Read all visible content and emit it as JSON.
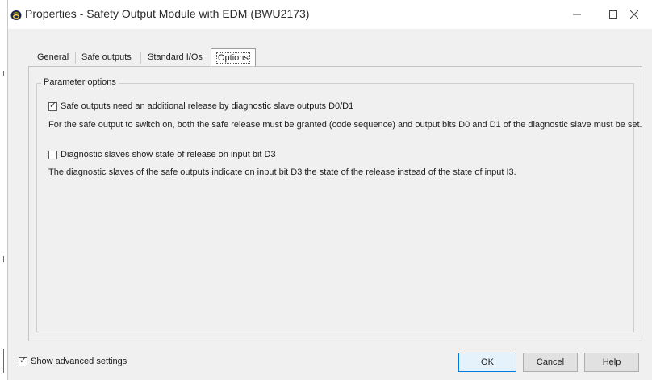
{
  "window": {
    "title": "Properties - Safety Output Module with EDM (BWU2173)",
    "minimize_glyph": "—",
    "maximize_glyph": "☐",
    "close_glyph": "✕"
  },
  "tabs": [
    {
      "label": "General",
      "active": false
    },
    {
      "label": "Safe outputs",
      "active": false
    },
    {
      "label": "Standard I/Os",
      "active": false
    },
    {
      "label": "Options",
      "active": true
    }
  ],
  "options": {
    "group_title": "Parameter options",
    "option1": {
      "label": "Safe outputs need an additional release by diagnostic slave outputs D0/D1",
      "checked": true,
      "description": "For the safe output to switch on, both the safe release must be granted (code sequence) and output bits D0 and D1 of the diagnostic slave must be set."
    },
    "option2": {
      "label": "Diagnostic slaves show state of release on input bit D3",
      "checked": false,
      "description": "The diagnostic slaves of the safe outputs indicate on input bit D3 the state of the release instead of the state of input I3."
    }
  },
  "footer": {
    "show_advanced": {
      "label": "Show advanced settings",
      "checked": true
    },
    "ok_label": "OK",
    "cancel_label": "Cancel",
    "help_label": "Help"
  },
  "colors": {
    "window_bg": "#f0f0f0",
    "titlebar_bg": "#ffffff",
    "default_button_border": "#0078d7"
  },
  "icons": {
    "app": "app-logo-icon",
    "check": "checkmark-icon"
  }
}
